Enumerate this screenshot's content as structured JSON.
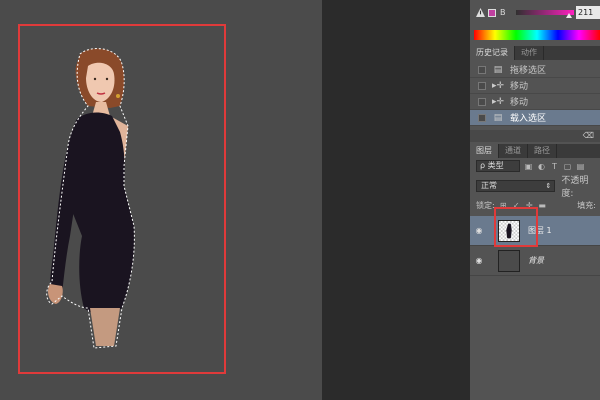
{
  "color_panel": {
    "channel_label": "B",
    "value": "211"
  },
  "history_panel": {
    "tabs": [
      "历史记录",
      "动作"
    ],
    "items": [
      {
        "label": "拖移选区",
        "icon": "history-doc-icon",
        "selected": false
      },
      {
        "label": "移动",
        "icon": "move-tool-icon",
        "selected": false
      },
      {
        "label": "移动",
        "icon": "move-tool-icon",
        "selected": false
      },
      {
        "label": "载入选区",
        "icon": "history-doc-icon",
        "selected": true
      }
    ]
  },
  "layers_panel": {
    "tabs": [
      "图层",
      "通道",
      "路径"
    ],
    "filter_label": "ρ 类型",
    "blend_mode": "正常",
    "opacity_label": "不透明度:",
    "lock_label": "锁定:",
    "fill_label": "填充:",
    "layers": [
      {
        "name": "图层 1",
        "selected": true
      },
      {
        "name": "背景",
        "selected": false
      }
    ]
  },
  "colors": {
    "highlight": "#e03a3a",
    "selected_row": "#6a7a8e",
    "canvas_bg": "#4b4b4b"
  }
}
